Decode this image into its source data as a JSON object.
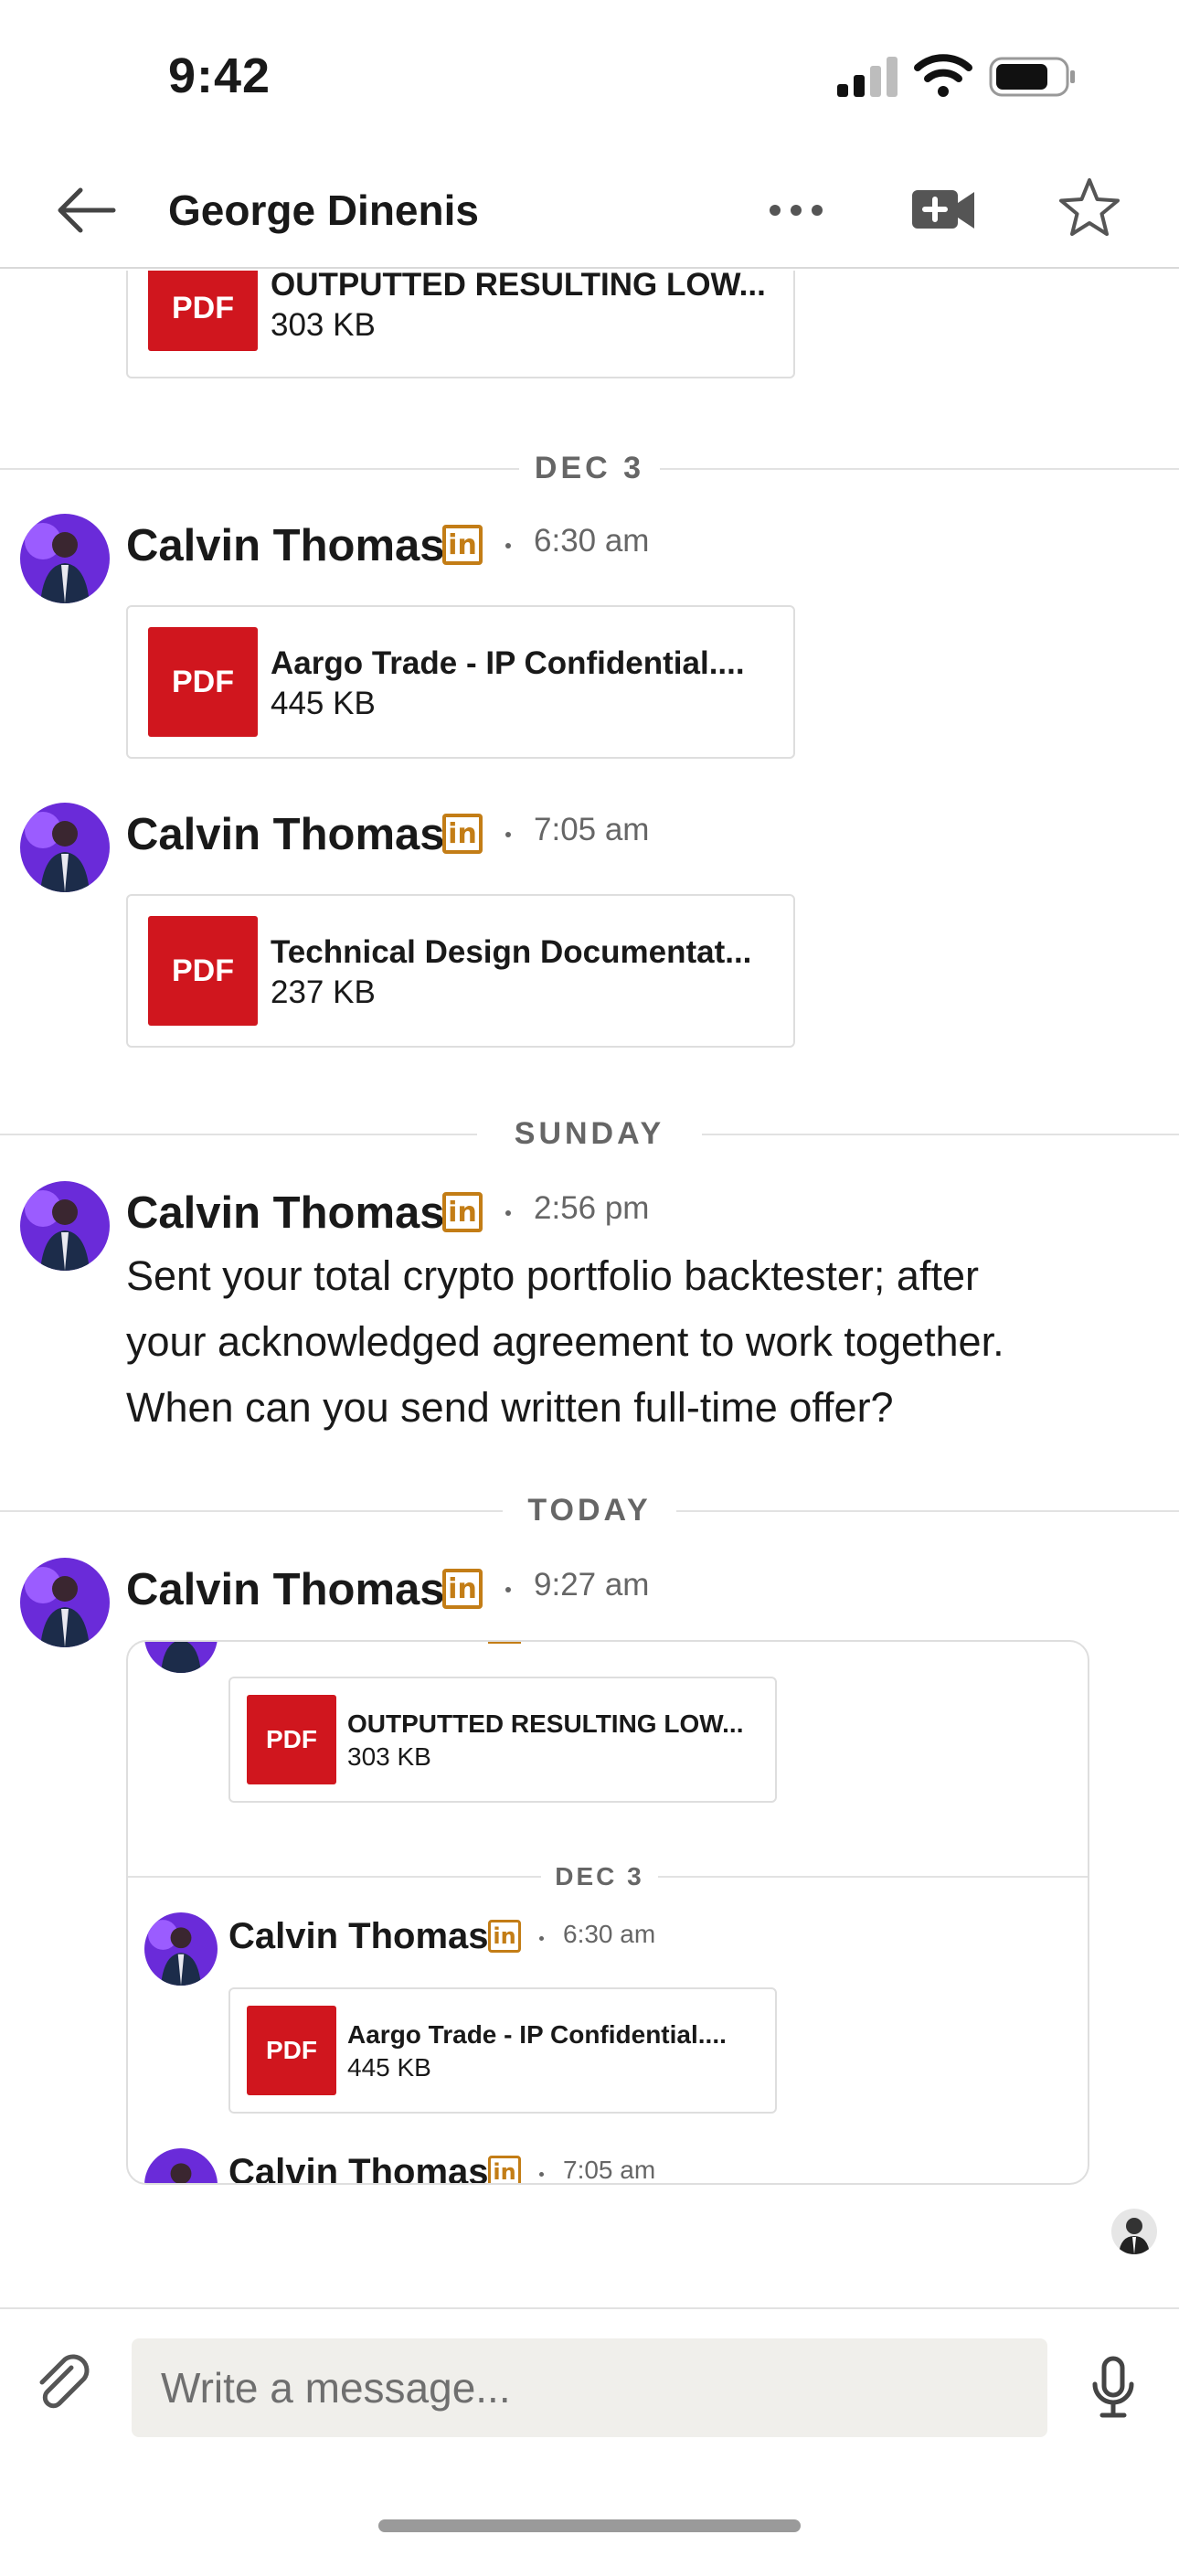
{
  "status_bar": {
    "time": "9:42"
  },
  "header": {
    "title": "George Dinenis"
  },
  "feed": {
    "top_file": {
      "badge": "PDF",
      "name": "OUTPUTTED RESULTING LOW...",
      "size": "303 KB"
    },
    "day_labels": [
      "DEC 3",
      "SUNDAY",
      "TODAY"
    ],
    "messages": [
      {
        "sender": "Calvin Thomas",
        "time": "6:30 am",
        "file": {
          "badge": "PDF",
          "name": "Aargo Trade - IP Confidential....",
          "size": "445 KB"
        }
      },
      {
        "sender": "Calvin Thomas",
        "time": "7:05 am",
        "file": {
          "badge": "PDF",
          "name": "Technical Design Documentat...",
          "size": "237 KB"
        }
      },
      {
        "sender": "Calvin Thomas",
        "time": "2:56 pm",
        "text_lines": [
          "Sent your total crypto portfolio backtester; after",
          "your acknowledged agreement to work together.",
          "When can you send written full-time offer?"
        ]
      },
      {
        "sender": "Calvin Thomas",
        "time": "9:27 am"
      }
    ],
    "quoted": {
      "top_file": {
        "badge": "PDF",
        "name": "OUTPUTTED RESULTING LOW...",
        "size": "303 KB"
      },
      "day_label": "DEC 3",
      "messages": [
        {
          "sender": "Calvin Thomas",
          "time": "6:30 am",
          "file": {
            "badge": "PDF",
            "name": "Aargo Trade - IP Confidential....",
            "size": "445 KB"
          }
        },
        {
          "sender": "Calvin Thomas",
          "time": "7:05 am"
        }
      ]
    }
  },
  "composer": {
    "placeholder": "Write a message..."
  },
  "badge_text": "in",
  "colors": {
    "pdf_red": "#d0161e",
    "linkedin_gold": "#c37d16",
    "avatar_purple": "#6a2bd9"
  }
}
